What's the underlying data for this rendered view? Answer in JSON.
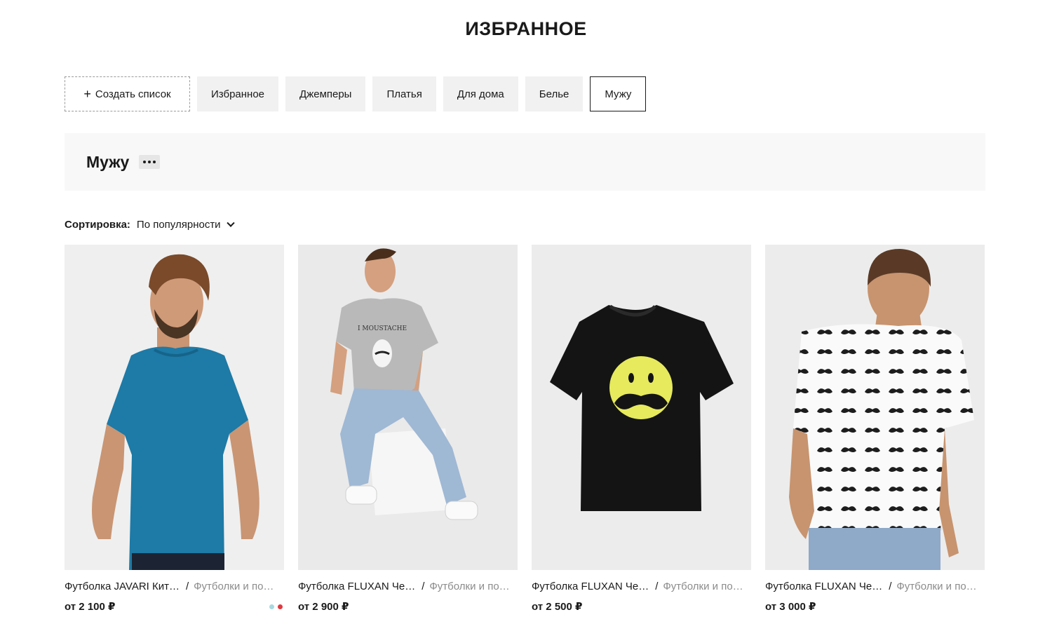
{
  "page": {
    "title": "ИЗБРАННОЕ"
  },
  "tabs": {
    "create_label": "Создать список",
    "create_icon": "plus-icon",
    "items": [
      {
        "label": "Избранное"
      },
      {
        "label": "Джемперы"
      },
      {
        "label": "Платья"
      },
      {
        "label": "Для дома"
      },
      {
        "label": "Белье"
      },
      {
        "label": "Мужу",
        "active": true
      }
    ]
  },
  "list": {
    "title": "Мужу",
    "menu_icon": "more-dots-icon"
  },
  "sort": {
    "label": "Сортировка:",
    "value": "По популярности",
    "icon": "chevron-down-icon"
  },
  "products": [
    {
      "name": "Футболка JAVARI Кит…",
      "separator": "/",
      "category": "Футболки и по…",
      "price": "от 2 100 ₽",
      "swatches": [
        "#a8d8e0",
        "#e0393f"
      ]
    },
    {
      "name": "Футболка FLUXAN Че…",
      "separator": "/",
      "category": "Футболки и по…",
      "price": "от 2 900 ₽",
      "tshirt_print": "I MOUSTACHE",
      "swatches": []
    },
    {
      "name": "Футболка FLUXAN Че…",
      "separator": "/",
      "category": "Футболки и по…",
      "price": "от 2 500 ₽",
      "swatches": []
    },
    {
      "name": "Футболка FLUXAN Че…",
      "separator": "/",
      "category": "Футболки и по…",
      "price": "от 3 000 ₽",
      "swatches": []
    }
  ],
  "colors": {
    "text": "#1a1a1a",
    "muted": "#8c8c8c",
    "tab_bg": "#f1f1f1",
    "header_bg": "#f8f8f8",
    "photo_bg": "#eeeeee"
  }
}
